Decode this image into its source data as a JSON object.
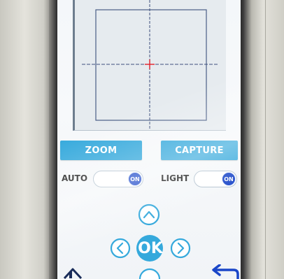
{
  "toolbar": {
    "zoom_label": "ZOOM",
    "capture_label": "CAPTURE"
  },
  "toggles": [
    {
      "label": "AUTO",
      "state": "ON"
    },
    {
      "label": "LIGHT",
      "state": "ON"
    }
  ],
  "dpad": {
    "ok_label": "OK",
    "icons": [
      "chevron-up-icon",
      "chevron-left-icon",
      "chevron-right-icon",
      "chevron-down-icon",
      "home-icon",
      "back-arrow-icon"
    ]
  },
  "colors": {
    "button": "#35a9dc",
    "toggle_knob": "#1a46c8",
    "crosshair_center": "#e0202a",
    "dpad": "#35a9dc"
  }
}
